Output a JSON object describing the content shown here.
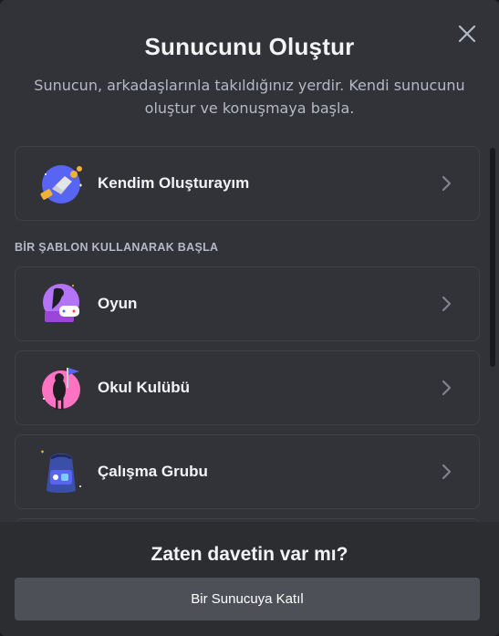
{
  "modal": {
    "title": "Sunucunu Oluştur",
    "subtitle": "Sunucun, arkadaşlarınla takıldığınız yerdir. Kendi sunucunu oluştur ve konuşmaya başla."
  },
  "options": {
    "create_own": "Kendim Oluşturayım",
    "section_label": "BİR ŞABLON KULLANARAK BAŞLA",
    "templates": [
      "Oyun",
      "Okul Kulübü",
      "Çalışma Grubu"
    ]
  },
  "footer": {
    "title": "Zaten davetin var mı?",
    "join_button": "Bir Sunucuya Katıl"
  },
  "icons": {
    "close": "close-icon",
    "chevron": "chevron-right-icon"
  },
  "colors": {
    "modal_bg": "#313338",
    "footer_bg": "#2b2d31",
    "button_bg": "#4e5058",
    "text_primary": "#f2f3f5",
    "text_secondary": "#b5bac1"
  }
}
